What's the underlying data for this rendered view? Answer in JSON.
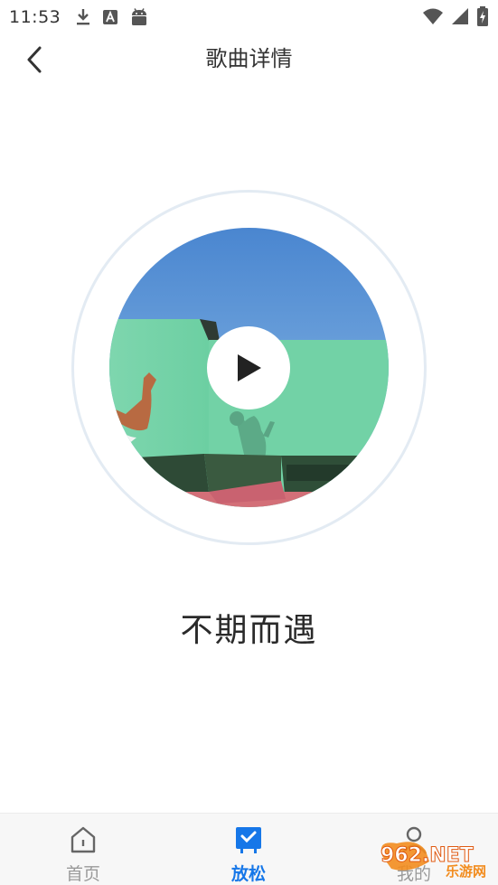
{
  "status_bar": {
    "time": "11:53",
    "icons": [
      "download-icon",
      "a-badge-icon",
      "android-icon",
      "wifi-icon",
      "signal-icon",
      "battery-charging-icon"
    ]
  },
  "header": {
    "title": "歌曲详情",
    "back_icon": "chevron-left-icon"
  },
  "player": {
    "song_title": "不期而遇",
    "play_icon": "play-icon"
  },
  "bottom_nav": {
    "items": [
      {
        "label": "首页",
        "icon": "home-icon",
        "active": false
      },
      {
        "label": "放松",
        "icon": "relax-calendar-icon",
        "active": true
      },
      {
        "label": "我的",
        "icon": "user-icon",
        "active": false
      }
    ]
  },
  "watermark": {
    "text_big": "962.NET",
    "text_small": "乐游网"
  },
  "colors": {
    "accent": "#1677e8",
    "inactive": "#9a9a9a",
    "disc_ring": "#e3ebf3"
  }
}
